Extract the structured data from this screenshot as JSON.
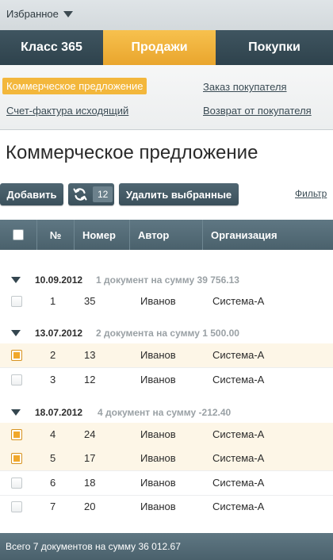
{
  "favorites": {
    "label": "Избранное"
  },
  "tabs": [
    {
      "label": "Класс 365"
    },
    {
      "label": "Продажи",
      "active": true
    },
    {
      "label": "Покупки"
    }
  ],
  "subnav": [
    {
      "label": "Коммерческое предложение",
      "active": true
    },
    {
      "label": "Заказ покупателя"
    },
    {
      "label": "Счет-фактура исходящий"
    },
    {
      "label": "Возврат от покупателя"
    }
  ],
  "page": {
    "title": "Коммерческое предложение"
  },
  "toolbar": {
    "add_label": "Добавить",
    "refresh_count": "12",
    "delete_label": "Удалить выбранные",
    "filter_label": "Фильтр"
  },
  "table": {
    "columns": [
      "№",
      "Номер",
      "Автор",
      "Организация"
    ],
    "groups": [
      {
        "date": "10.09.2012",
        "summary": "1 документ на сумму 39 756.13",
        "rows": [
          {
            "n": "1",
            "number": "35",
            "author": "Иванов",
            "org": "Система-А",
            "checked": false
          }
        ]
      },
      {
        "date": "13.07.2012",
        "summary": "2 документа на сумму 1 500.00",
        "rows": [
          {
            "n": "2",
            "number": "13",
            "author": "Иванов",
            "org": "Система-А",
            "checked": true
          },
          {
            "n": "3",
            "number": "12",
            "author": "Иванов",
            "org": "Система-А",
            "checked": false
          }
        ]
      },
      {
        "date": "18.07.2012",
        "summary": "4 документ на сумму -212.40",
        "rows": [
          {
            "n": "4",
            "number": "24",
            "author": "Иванов",
            "org": "Система-А",
            "checked": true
          },
          {
            "n": "5",
            "number": "17",
            "author": "Иванов",
            "org": "Система-А",
            "checked": true
          },
          {
            "n": "6",
            "number": "18",
            "author": "Иванов",
            "org": "Система-А",
            "checked": false
          },
          {
            "n": "7",
            "number": "20",
            "author": "Иванов",
            "org": "Система-А",
            "checked": false
          }
        ]
      }
    ]
  },
  "footer": {
    "summary": "Всего 7 документов на сумму 36 012.67"
  },
  "colors": {
    "accent": "#f3b73c",
    "header_dark": "#3f5560",
    "table_header": "#5f7783",
    "selected_row": "#fdf6e7"
  }
}
